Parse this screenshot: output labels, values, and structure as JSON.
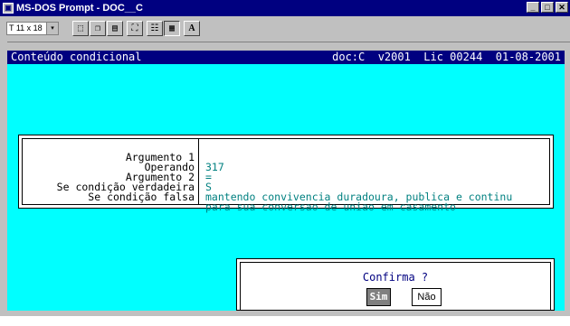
{
  "window": {
    "title": "MS-DOS Prompt - DOC__C",
    "app_icon": "msdos-icon",
    "buttons": [
      "minimize",
      "maximize",
      "close"
    ]
  },
  "toolbar": {
    "font_size": "T 11 x 18",
    "font_dropdown_glyph": "▾",
    "buttons": [
      "mark-icon",
      "copy-icon",
      "paste-icon",
      "fullscreen-icon",
      "properties-icon",
      "background-icon",
      "font-icon"
    ],
    "font_button_label": "A"
  },
  "screen": {
    "header_left": "Conteúdo condicional",
    "header_right": "doc:C  v2001  Lic 00244  01-08-2001"
  },
  "condition": {
    "rows": [
      {
        "label": "Argumento 1",
        "value": "317"
      },
      {
        "label": "Operando",
        "value": "="
      },
      {
        "label": "Argumento 2",
        "value": "S"
      },
      {
        "label": "Se condição verdadeira",
        "value": "mantendo convivencia duradoura, publica e continu"
      },
      {
        "label": "Se condição falsa",
        "value": "para sua conversao de uniao em casamento"
      }
    ]
  },
  "dialog": {
    "question": "Confirma ?",
    "yes_label": "Sim",
    "no_label": "Não"
  },
  "colors": {
    "screen_bg": "#00ffff",
    "header_bg": "#000080",
    "value_text": "#008080"
  }
}
